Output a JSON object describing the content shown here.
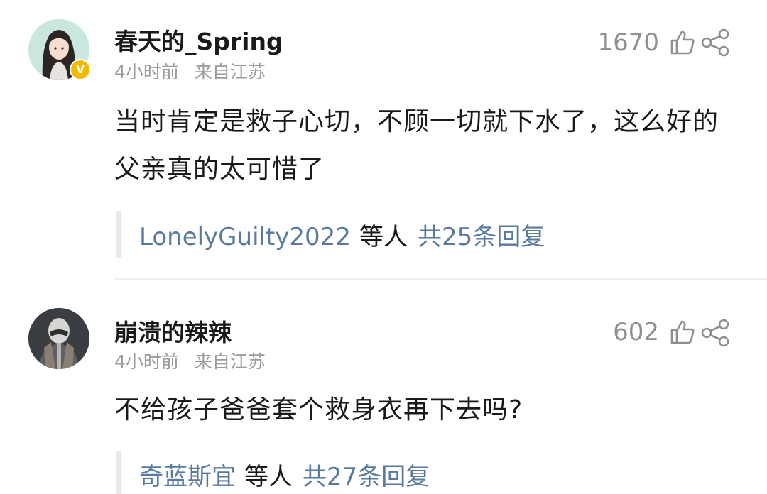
{
  "comments": [
    {
      "username": "春天的_Spring",
      "time": "4小时前",
      "location": "来自江苏",
      "likes": "1670",
      "text": "当时肯定是救子心切，不顾一切就下水了，这么好的父亲真的太可惜了",
      "reply_user": "LonelyGuilty2022",
      "reply_etc": "等人",
      "reply_count": "共25条回复",
      "avatar_icon": "girl-avatar-icon",
      "badge_icon": "verified-v-badge-icon"
    },
    {
      "username": "崩溃的辣辣",
      "time": "4小时前",
      "location": "来自江苏",
      "likes": "602",
      "text": "不给孩子爸爸套个救身衣再下去吗?",
      "reply_user": "奇蓝斯宜",
      "reply_etc": "等人",
      "reply_count": "共27条回复",
      "avatar_icon": "armored-hero-avatar-icon"
    }
  ],
  "colors": {
    "text": "#1a1a1a",
    "meta": "#9a9a9a",
    "link": "#577a9e",
    "reply_bar": "#e9e9e9",
    "badge": "#f5b800"
  },
  "icons": [
    "thumbs-up-icon",
    "share-icon"
  ]
}
